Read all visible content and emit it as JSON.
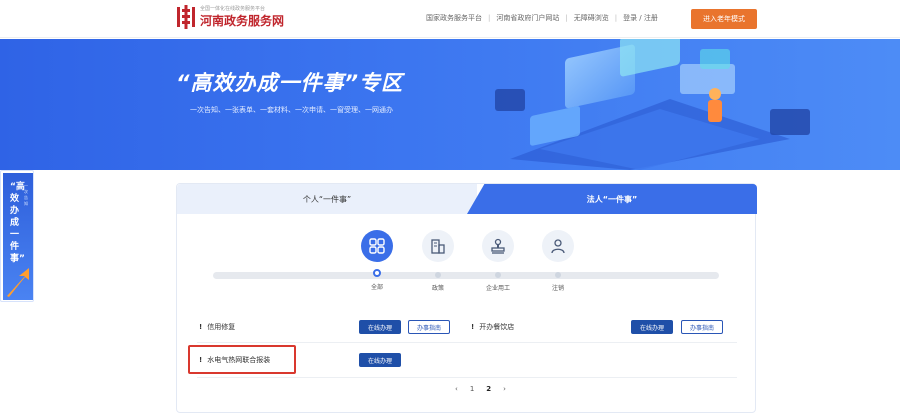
{
  "header": {
    "logo_sub": "全国一体化在线政务服务平台",
    "logo_title": "河南政务服务网",
    "nav": [
      {
        "label": "国家政务服务平台"
      },
      {
        "label": "河南省政府门户网站"
      },
      {
        "label": "无障碍浏览"
      },
      {
        "label": "登录 / 注册"
      }
    ],
    "elder_mode_label": "进入老年模式",
    "brand_color": "#c0262d",
    "elder_color": "#e9742d"
  },
  "banner": {
    "title": "“高效办成一件事”专区",
    "subtitle": "一次告知、一张表单、一套材料、一次申请、一窗受理、一网通办",
    "bg_color": "#2f63e6"
  },
  "side_float": {
    "title": "“高效办成一件事”",
    "subtitle": "一次告知"
  },
  "tabs": [
    {
      "label": "个人“一件事”",
      "active": false
    },
    {
      "label": "法人“一件事”",
      "active": true
    }
  ],
  "categories": [
    {
      "label": "全部",
      "icon": "grid-icon",
      "active": true
    },
    {
      "label": "政策",
      "icon": "building-icon",
      "active": false
    },
    {
      "label": "企业用工",
      "icon": "stamp-icon",
      "active": false
    },
    {
      "label": "注销",
      "icon": "person-icon",
      "active": false
    }
  ],
  "items": [
    {
      "name": "信用修复",
      "online_label": "在线办理",
      "guide_label": "办事指南"
    },
    {
      "name": "开办餐饮店",
      "online_label": "在线办理",
      "guide_label": "办事指南"
    },
    {
      "name": "水电气热网联合报装",
      "online_label": "在线办理",
      "highlighted": true
    }
  ],
  "pager": {
    "prev": "‹",
    "pages": [
      "1",
      "2"
    ],
    "current": "2",
    "next": "›"
  },
  "accent_color": "#3a6ee8",
  "highlight_color": "#d9382e"
}
